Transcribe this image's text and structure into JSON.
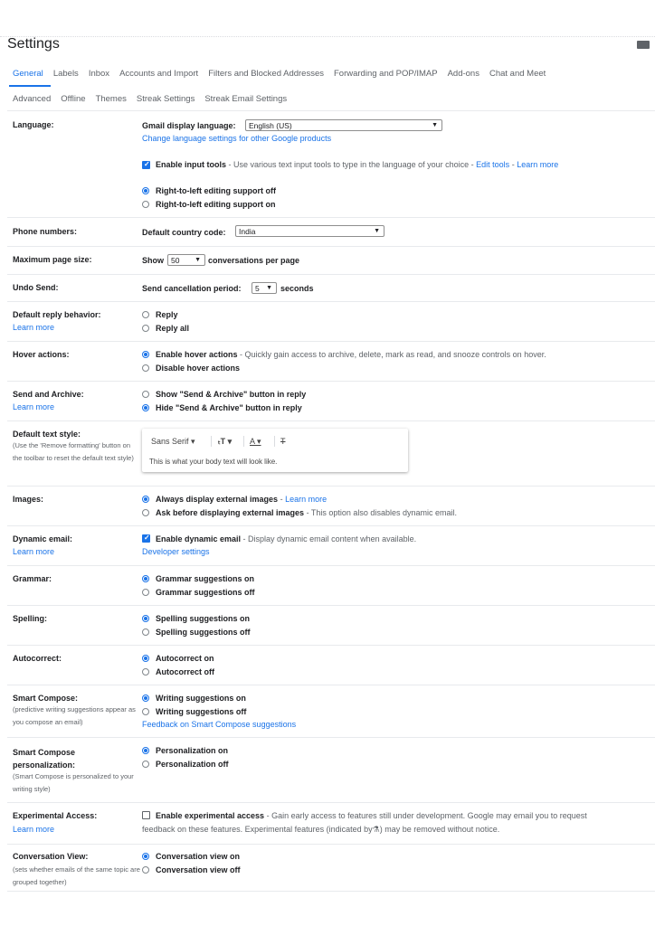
{
  "header": {
    "title": "Settings"
  },
  "tabs_row1": [
    {
      "label": "General",
      "active": true
    },
    {
      "label": "Labels"
    },
    {
      "label": "Inbox"
    },
    {
      "label": "Accounts and Import"
    },
    {
      "label": "Filters and Blocked Addresses"
    },
    {
      "label": "Forwarding and POP/IMAP"
    },
    {
      "label": "Add-ons"
    },
    {
      "label": "Chat and Meet"
    }
  ],
  "tabs_row2": [
    {
      "label": "Advanced"
    },
    {
      "label": "Offline"
    },
    {
      "label": "Themes"
    },
    {
      "label": "Streak Settings"
    },
    {
      "label": "Streak Email Settings"
    }
  ],
  "language": {
    "label": "Language:",
    "display_label": "Gmail display language:",
    "display_value": "English (US)",
    "change_link": "Change language settings for other Google products",
    "input_tools_label": "Enable input tools",
    "input_tools_desc": " - Use various text input tools to type in the language of your choice - ",
    "edit_tools": "Edit tools",
    "dash": " - ",
    "learn_more": "Learn more",
    "rtl_off": "Right-to-left editing support off",
    "rtl_on": "Right-to-left editing support on"
  },
  "phone": {
    "label": "Phone numbers:",
    "country_label": "Default country code:",
    "country_value": "India"
  },
  "page_size": {
    "label": "Maximum page size:",
    "show": "Show",
    "value": "50",
    "suffix": "conversations per page"
  },
  "undo": {
    "label": "Undo Send:",
    "period_label": "Send cancellation period:",
    "value": "5",
    "suffix": "seconds"
  },
  "reply": {
    "label": "Default reply behavior:",
    "learn_more": "Learn more",
    "opt1": "Reply",
    "opt2": "Reply all"
  },
  "hover": {
    "label": "Hover actions:",
    "opt1": "Enable hover actions",
    "opt1_desc": " - Quickly gain access to archive, delete, mark as read, and snooze controls on hover.",
    "opt2": "Disable hover actions"
  },
  "send_archive": {
    "label": "Send and Archive:",
    "learn_more": "Learn more",
    "opt1": "Show \"Send & Archive\" button in reply",
    "opt2": "Hide \"Send & Archive\" button in reply"
  },
  "text_style": {
    "label": "Default text style:",
    "sub": "(Use the 'Remove formatting' button on the toolbar to reset the default text style)",
    "font": "Sans Serif",
    "preview": "This is what your body text will look like."
  },
  "images": {
    "label": "Images:",
    "opt1": "Always display external images",
    "opt1_sep": " - ",
    "learn_more": "Learn more",
    "opt2": "Ask before displaying external images",
    "opt2_desc": " - This option also disables dynamic email."
  },
  "dynamic": {
    "label": "Dynamic email:",
    "learn_more": "Learn more",
    "opt": "Enable dynamic email",
    "opt_desc": " - Display dynamic email content when available.",
    "dev_link": "Developer settings"
  },
  "grammar": {
    "label": "Grammar:",
    "opt1": "Grammar suggestions on",
    "opt2": "Grammar suggestions off"
  },
  "spelling": {
    "label": "Spelling:",
    "opt1": "Spelling suggestions on",
    "opt2": "Spelling suggestions off"
  },
  "autocorrect": {
    "label": "Autocorrect:",
    "opt1": "Autocorrect on",
    "opt2": "Autocorrect off"
  },
  "smart_compose": {
    "label": "Smart Compose:",
    "sub": "(predictive writing suggestions appear as you compose an email)",
    "opt1": "Writing suggestions on",
    "opt2": "Writing suggestions off",
    "feedback": "Feedback on Smart Compose suggestions"
  },
  "sc_personal": {
    "label": "Smart Compose personalization:",
    "sub": "(Smart Compose is personalized to your writing style)",
    "opt1": "Personalization on",
    "opt2": "Personalization off"
  },
  "experimental": {
    "label": "Experimental Access:",
    "learn_more": "Learn more",
    "opt": "Enable experimental access",
    "desc1": " - Gain early access to features still under development. Google may email you to request",
    "desc2": "feedback on these features. Experimental features (indicated by",
    "desc3": ") may be removed without notice."
  },
  "conversation": {
    "label": "Conversation View:",
    "sub": "(sets whether emails of the same topic are grouped together)",
    "opt1": "Conversation view on",
    "opt2": "Conversation view off"
  }
}
